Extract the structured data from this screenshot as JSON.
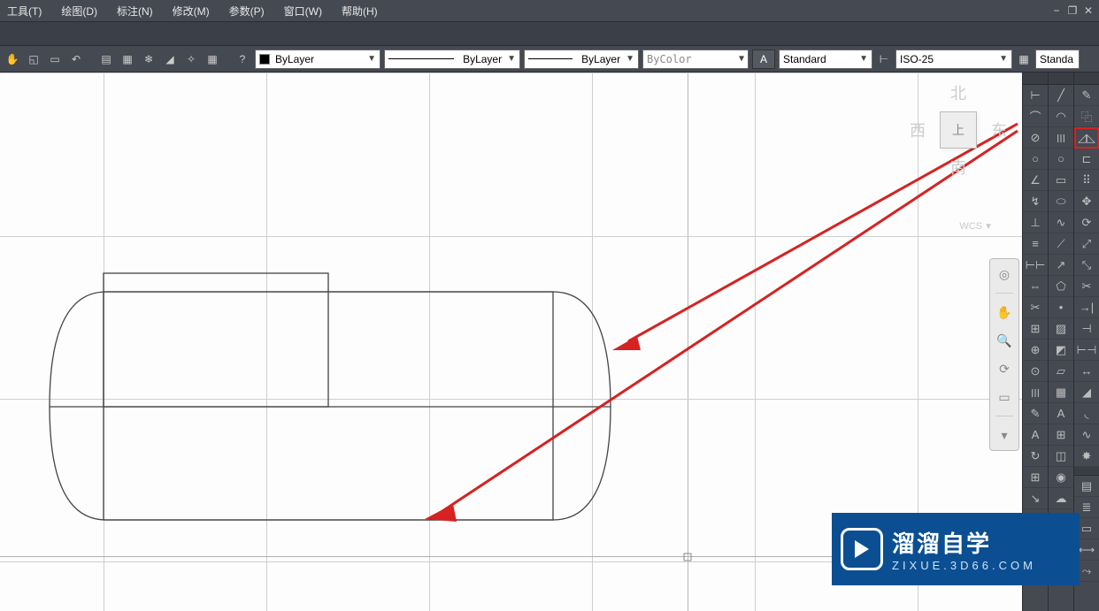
{
  "menus": {
    "tool": "工具(T)",
    "draw": "绘图(D)",
    "annotate": "标注(N)",
    "modify": "修改(M)",
    "param": "参数(P)",
    "window": "窗口(W)",
    "help": "帮助(H)"
  },
  "window_controls": {
    "min": "−",
    "restore": "❐",
    "close": "✕"
  },
  "toolbar": {
    "layer": "ByLayer",
    "linetype": "ByLayer",
    "lineweight": "ByLayer",
    "color": "ByColor",
    "textstyle": "Standard",
    "dimstyle": "ISO-25",
    "tablestyle": "Standa"
  },
  "viewcube": {
    "top": "上",
    "north": "北",
    "south": "南",
    "east": "东",
    "west": "西",
    "wcs": "WCS"
  },
  "watermark": {
    "title": "溜溜自学",
    "url": "ZIXUE.3D66.COM"
  },
  "mirror_tool_name": "mirror-icon"
}
